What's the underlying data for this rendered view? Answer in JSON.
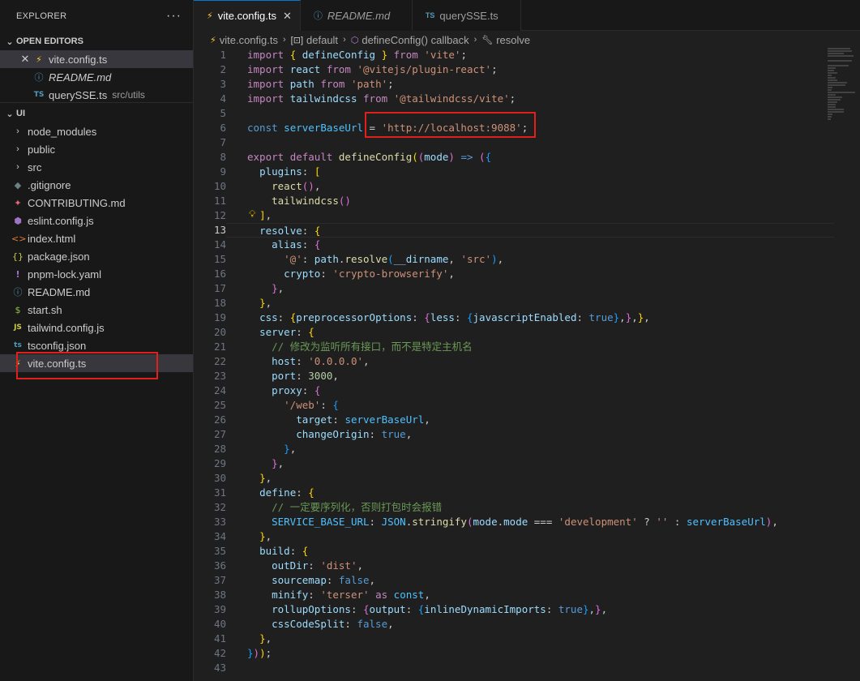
{
  "sidebar": {
    "title": "EXPLORER",
    "more": "···",
    "open_editors": {
      "title": "OPEN EDITORS",
      "items": [
        {
          "name": "vite.config.ts",
          "desc": ""
        },
        {
          "name": "README.md",
          "desc": ""
        },
        {
          "name": "querySSE.ts",
          "desc": "src/utils"
        }
      ]
    },
    "folder": {
      "title": "UI",
      "items": [
        {
          "name": "node_modules"
        },
        {
          "name": "public"
        },
        {
          "name": "src"
        },
        {
          "name": ".gitignore"
        },
        {
          "name": "CONTRIBUTING.md"
        },
        {
          "name": "eslint.config.js"
        },
        {
          "name": "index.html"
        },
        {
          "name": "package.json"
        },
        {
          "name": "pnpm-lock.yaml"
        },
        {
          "name": "README.md"
        },
        {
          "name": "start.sh"
        },
        {
          "name": "tailwind.config.js"
        },
        {
          "name": "tsconfig.json"
        },
        {
          "name": "vite.config.ts"
        }
      ]
    }
  },
  "tabs": [
    {
      "label": "vite.config.ts"
    },
    {
      "label": "README.md"
    },
    {
      "label": "querySSE.ts"
    }
  ],
  "breadcrumb": {
    "file": "vite.config.ts",
    "part1": "default",
    "part2": "defineConfig() callback",
    "part3": "resolve"
  },
  "editor": {
    "current_line": 13,
    "line_numbers": [
      "1",
      "2",
      "3",
      "4",
      "5",
      "6",
      "7",
      "8",
      "9",
      "10",
      "11",
      "12",
      "13",
      "14",
      "15",
      "16",
      "17",
      "18",
      "19",
      "20",
      "21",
      "22",
      "23",
      "24",
      "25",
      "26",
      "27",
      "28",
      "29",
      "30",
      "31",
      "32",
      "33",
      "34",
      "35",
      "36",
      "37",
      "38",
      "39",
      "40",
      "41",
      "42",
      "43"
    ]
  },
  "icons": {
    "vite": "vite-icon",
    "info": "info-icon",
    "ts": "ts-icon",
    "folder-chevron": "chevron-right-icon"
  },
  "colors": {
    "highlight_box": "#e0201b",
    "accent": "#0078d4"
  }
}
